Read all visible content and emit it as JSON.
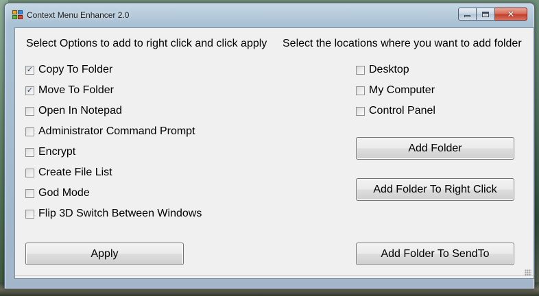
{
  "window": {
    "title": "Context Menu Enhancer 2.0",
    "close_glyph": "✕"
  },
  "left_panel": {
    "heading": "Select Options to add to right click and click apply",
    "options": [
      {
        "label": "Copy To Folder",
        "checked": true
      },
      {
        "label": "Move To Folder",
        "checked": true
      },
      {
        "label": "Open In Notepad",
        "checked": false
      },
      {
        "label": "Administrator Command Prompt",
        "checked": false
      },
      {
        "label": "Encrypt",
        "checked": false
      },
      {
        "label": "Create File List",
        "checked": false
      },
      {
        "label": "God Mode",
        "checked": false
      },
      {
        "label": "Flip 3D Switch Between Windows",
        "checked": false
      }
    ],
    "apply_label": "Apply"
  },
  "right_panel": {
    "heading": "Select the locations where you want to add folder",
    "locations": [
      {
        "label": "Desktop",
        "checked": false
      },
      {
        "label": "My Computer",
        "checked": false
      },
      {
        "label": "Control Panel",
        "checked": false
      }
    ],
    "add_folder_label": "Add Folder",
    "add_folder_right_click_label": "Add Folder To Right Click",
    "add_folder_sendto_label": "Add Folder To SendTo"
  },
  "check_glyph": "✓"
}
